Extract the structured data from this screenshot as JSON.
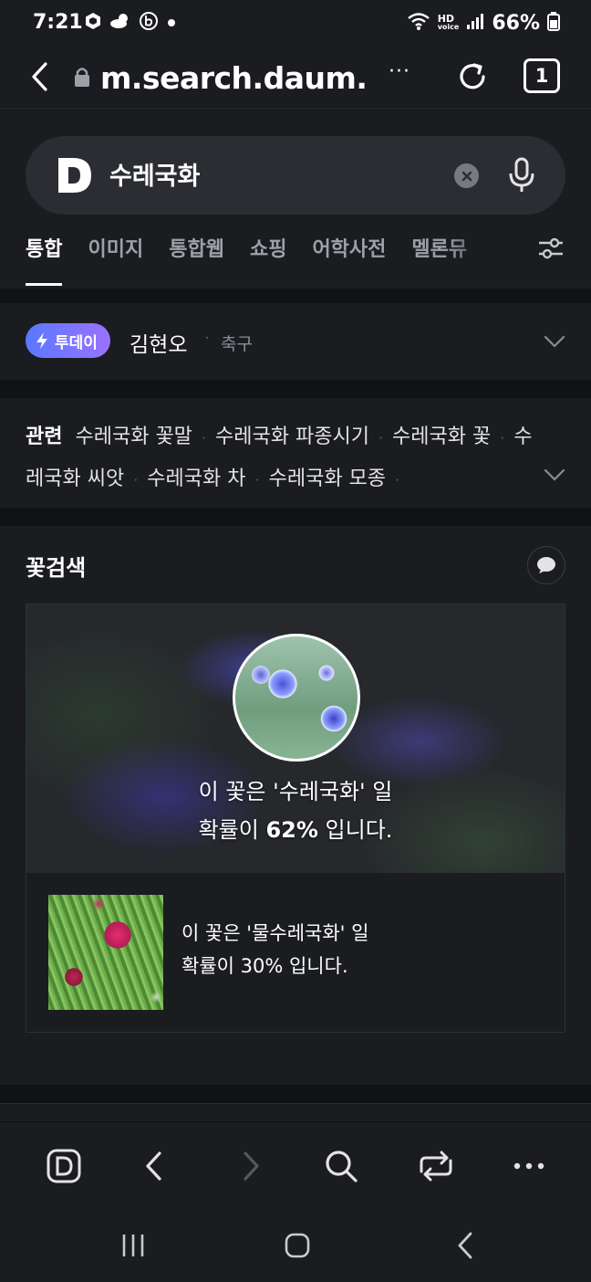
{
  "status_bar": {
    "time": "7:21",
    "battery": "66%",
    "network_top": "HD",
    "network_bottom": "voice"
  },
  "browser": {
    "url": "m.search.daum.",
    "more": "···",
    "tab_count": "1"
  },
  "search": {
    "query": "수레국화",
    "tabs": [
      {
        "label": "통합",
        "active": true
      },
      {
        "label": "이미지"
      },
      {
        "label": "통합웹"
      },
      {
        "label": "쇼핑"
      },
      {
        "label": "어학사전"
      },
      {
        "label": "멜론뮤"
      }
    ]
  },
  "today": {
    "badge": "투데이",
    "name": "김현오",
    "category": "축구"
  },
  "related": {
    "label": "관련",
    "items": [
      "수레국화 꽃말",
      "수레국화 파종시기",
      "수레국화 꽃",
      "수레국화 씨앗",
      "수레국화 차",
      "수레국화 모종"
    ]
  },
  "flower_search": {
    "title": "꽃검색",
    "main_result": {
      "line1": "이 꽃은 '수레국화' 일",
      "prob_prefix": "확률이 ",
      "probability": "62%",
      "prob_suffix": " 입니다."
    },
    "alt_result": {
      "line1": "이 꽃은 '물수레국화' 일",
      "line2": "확률이 30% 입니다."
    }
  },
  "icons": {
    "status_left": [
      "box-app-icon",
      "weather-icon",
      "b-app-icon",
      "dot-icon"
    ],
    "status_right": [
      "wifi-icon",
      "signal-icon",
      "battery-icon"
    ],
    "toolbar": [
      "daum-home-icon",
      "back-icon",
      "forward-icon",
      "search-icon",
      "tabs-switch-icon",
      "more-icon"
    ],
    "system": [
      "recents-icon",
      "home-icon",
      "back-icon"
    ]
  },
  "colors": {
    "background": "#1b1c20",
    "page_bg": "#111215",
    "badge_gradient_start": "#5a79ff",
    "badge_gradient_end": "#9a72ff"
  }
}
